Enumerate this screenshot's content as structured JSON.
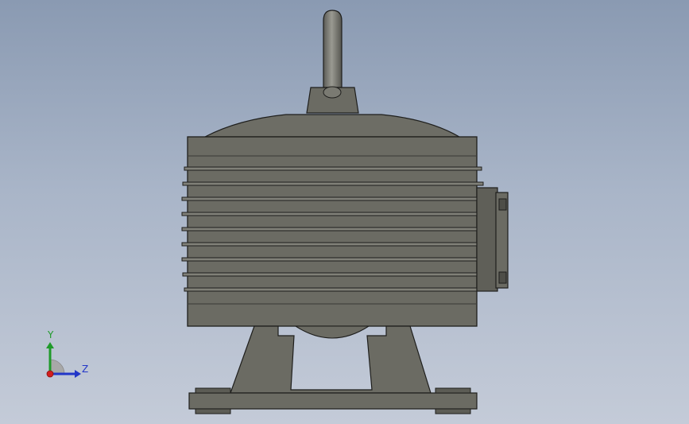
{
  "scene": {
    "view": "right",
    "model": "motor-assembly",
    "colors": {
      "background_top": "#8a9ab2",
      "background_bottom": "#c4cbd8",
      "body": "#6b6b63",
      "body_dark": "#55554f",
      "edge": "#1e1e1c"
    }
  },
  "triad": {
    "y_label": "Y",
    "z_label": "Z",
    "colors": {
      "y_axis": "#1f9a2a",
      "z_axis": "#2236c8",
      "x_axis": "#d21e1e"
    }
  }
}
